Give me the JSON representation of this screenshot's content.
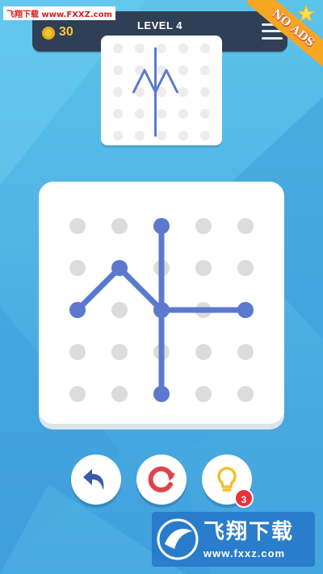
{
  "header": {
    "coins": "30",
    "level_title": "LEVEL 4"
  },
  "watermark": {
    "top_text": "飞翔下载 www.FXXZ.com",
    "logo_name": "飞翔下载",
    "logo_url": "www.fxxz.com"
  },
  "promo": {
    "label": "NO ADS"
  },
  "hint": {
    "count": "3"
  },
  "icons": {
    "coin": "coin-icon",
    "menu": "menu-icon",
    "star": "star-icon",
    "undo": "undo-arrow-icon",
    "restart": "restart-icon",
    "hint": "lightbulb-icon"
  },
  "colors": {
    "background": "#4fb4e6",
    "header_bar": "#2f3f55",
    "line": "#5c79cf",
    "dot": "#dcdcdc",
    "undo": "#3c5aa8",
    "restart": "#e3424d",
    "hint": "#f2c02c",
    "badge": "#e8333a",
    "promo": "#f5a623"
  },
  "puzzle": {
    "grid_size": 5,
    "target_lines": [
      [
        [
          1,
          2
        ],
        [
          2,
          1
        ],
        [
          3,
          2
        ]
      ],
      [
        [
          3,
          2
        ],
        [
          4,
          1
        ],
        [
          5,
          2
        ]
      ],
      [
        [
          3,
          0
        ],
        [
          3,
          4
        ]
      ]
    ],
    "player_lines": [
      [
        [
          0,
          2
        ],
        [
          1,
          1
        ],
        [
          2,
          2
        ],
        [
          4,
          2
        ]
      ],
      [
        [
          2,
          0
        ],
        [
          2,
          4
        ]
      ]
    ],
    "player_endpoints": [
      [
        0,
        2
      ],
      [
        1,
        1
      ],
      [
        2,
        0
      ],
      [
        2,
        2
      ],
      [
        4,
        2
      ],
      [
        2,
        4
      ]
    ]
  }
}
